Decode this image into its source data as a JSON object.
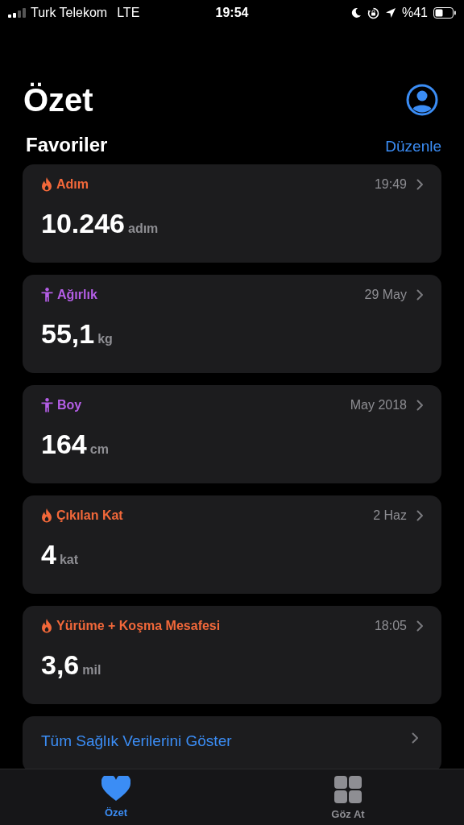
{
  "status_bar": {
    "carrier": "Turk Telekom",
    "network": "LTE",
    "time": "19:54",
    "battery": "%41"
  },
  "header": {
    "title": "Özet"
  },
  "favorites": {
    "title": "Favoriler",
    "edit": "Düzenle"
  },
  "cards": [
    {
      "kind": "activity",
      "color": "#f2683a",
      "label": "Adım",
      "date": "19:49",
      "value": "10.246",
      "unit": "adım"
    },
    {
      "kind": "body",
      "color": "#b45ee6",
      "label": "Ağırlık",
      "date": "29 May",
      "value": "55,1",
      "unit": "kg"
    },
    {
      "kind": "body",
      "color": "#b45ee6",
      "label": "Boy",
      "date": "May 2018",
      "value": "164",
      "unit": "cm"
    },
    {
      "kind": "activity",
      "color": "#f2683a",
      "label": "Çıkılan Kat",
      "date": "2 Haz",
      "value": "4",
      "unit": "kat"
    },
    {
      "kind": "activity",
      "color": "#f2683a",
      "label": "Yürüme + Koşma Mesafesi",
      "date": "18:05",
      "value": "3,6",
      "unit": "mil"
    }
  ],
  "show_all": "Tüm Sağlık Verilerini Göster",
  "tabs": [
    {
      "kind": "heart",
      "label": "Özet",
      "selected": true
    },
    {
      "kind": "grid",
      "label": "Göz At",
      "selected": false
    }
  ]
}
